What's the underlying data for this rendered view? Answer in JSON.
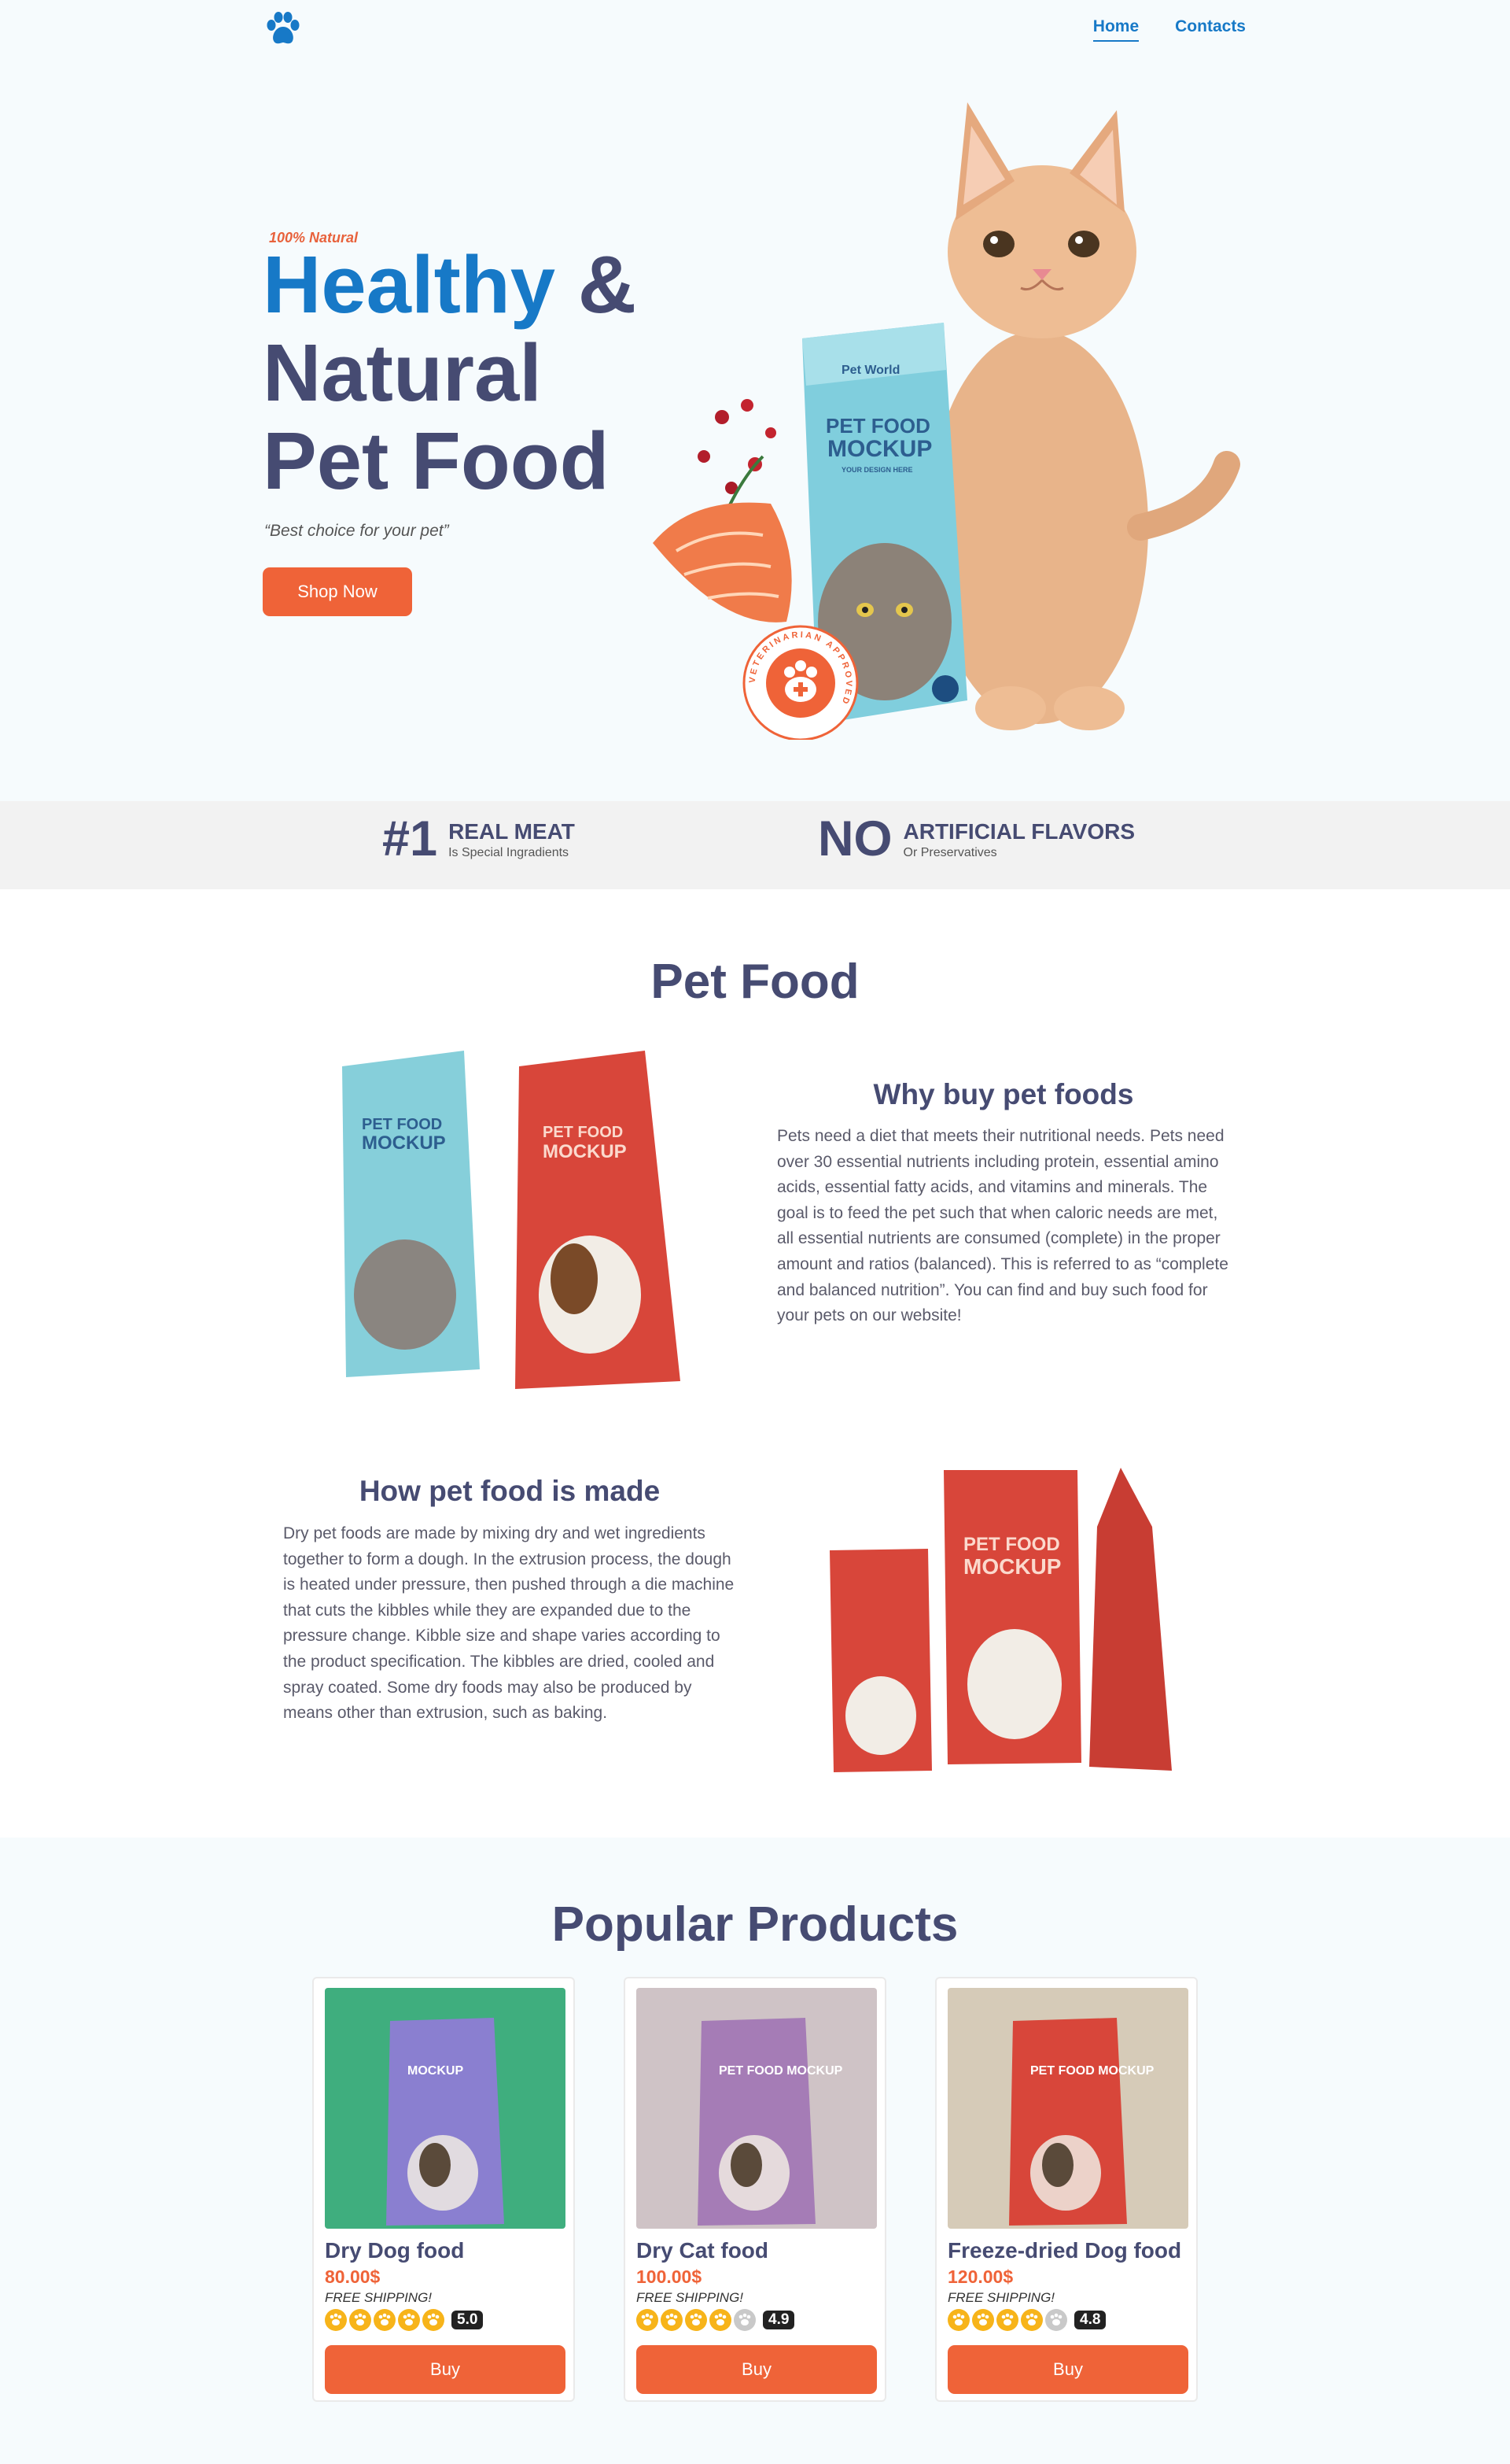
{
  "header": {
    "logo_icon": "paw-icon",
    "nav": [
      {
        "label": "Home",
        "active": true
      },
      {
        "label": "Contacts",
        "active": false
      }
    ]
  },
  "hero": {
    "kicker": "100% Natural",
    "title_line1_highlight": "Healthy",
    "title_line1_rest": " &",
    "title_line2": "Natural",
    "title_line3": "Pet Food",
    "tagline": "“Best choice for your pet”",
    "cta": "Shop Now",
    "bag": {
      "brand": "Pet World",
      "line1": "PET FOOD",
      "line2": "MOCKUP",
      "line3": "YOUR DESIGN HERE"
    },
    "badge": "VETERINARIAN APPROVED"
  },
  "features": [
    {
      "big": "#1",
      "title": "REAL MEAT",
      "sub": "Is Special Ingradients"
    },
    {
      "big": "NO",
      "title": "ARTIFICIAL FLAVORS",
      "sub": "Or Preservatives"
    }
  ],
  "pet_food": {
    "title": "Pet Food",
    "why": {
      "title": "Why buy pet foods",
      "text": "Pets need a diet that meets their nutritional needs. Pets need over 30 essential nutrients including protein, essential amino acids, essential fatty acids, and vitamins and minerals. The goal is to feed the pet such that when caloric needs are met, all essential nutrients are consumed (complete) in the proper amount and ratios (balanced). This is referred to as “complete and balanced nutrition”. You can find and buy such food for your pets on our website!"
    },
    "how": {
      "title": "How pet food is made",
      "text": "Dry pet foods are made by mixing dry and wet ingredients together to form a dough. In the extrusion process, the dough is heated under pressure, then pushed through a die machine that cuts the kibbles while they are expanded due to the pressure change. Kibble size and shape varies according to the product specification. The kibbles are dried, cooled and spray coated. Some dry foods may also be produced by means other than extrusion, such as baking."
    }
  },
  "products": {
    "title": "Popular Products",
    "items": [
      {
        "name": "Dry Dog food",
        "price": "80.00$",
        "shipping": "FREE SHIPPING!",
        "rating": "5.0",
        "stars": 5,
        "buy": "Buy",
        "bg": "#3fae7e",
        "bag": "#8a7fd0",
        "bag_text": "MOCKUP"
      },
      {
        "name": "Dry Cat food",
        "price": "100.00$",
        "shipping": "FREE SHIPPING!",
        "rating": "4.9",
        "stars": 4,
        "buy": "Buy",
        "bg": "#cfc3c6",
        "bag": "#a57cb6",
        "bag_text": "PET FOOD MOCKUP"
      },
      {
        "name": "Freeze-dried Dog food",
        "price": "120.00$",
        "shipping": "FREE SHIPPING!",
        "rating": "4.8",
        "stars": 4,
        "buy": "Buy",
        "bg": "#d6cbb8",
        "bag": "#d8463a",
        "bag_text": "PET FOOD MOCKUP"
      }
    ]
  },
  "colors": {
    "accent": "#ef6338",
    "brand_blue": "#1779c7",
    "heading": "#464b72"
  }
}
